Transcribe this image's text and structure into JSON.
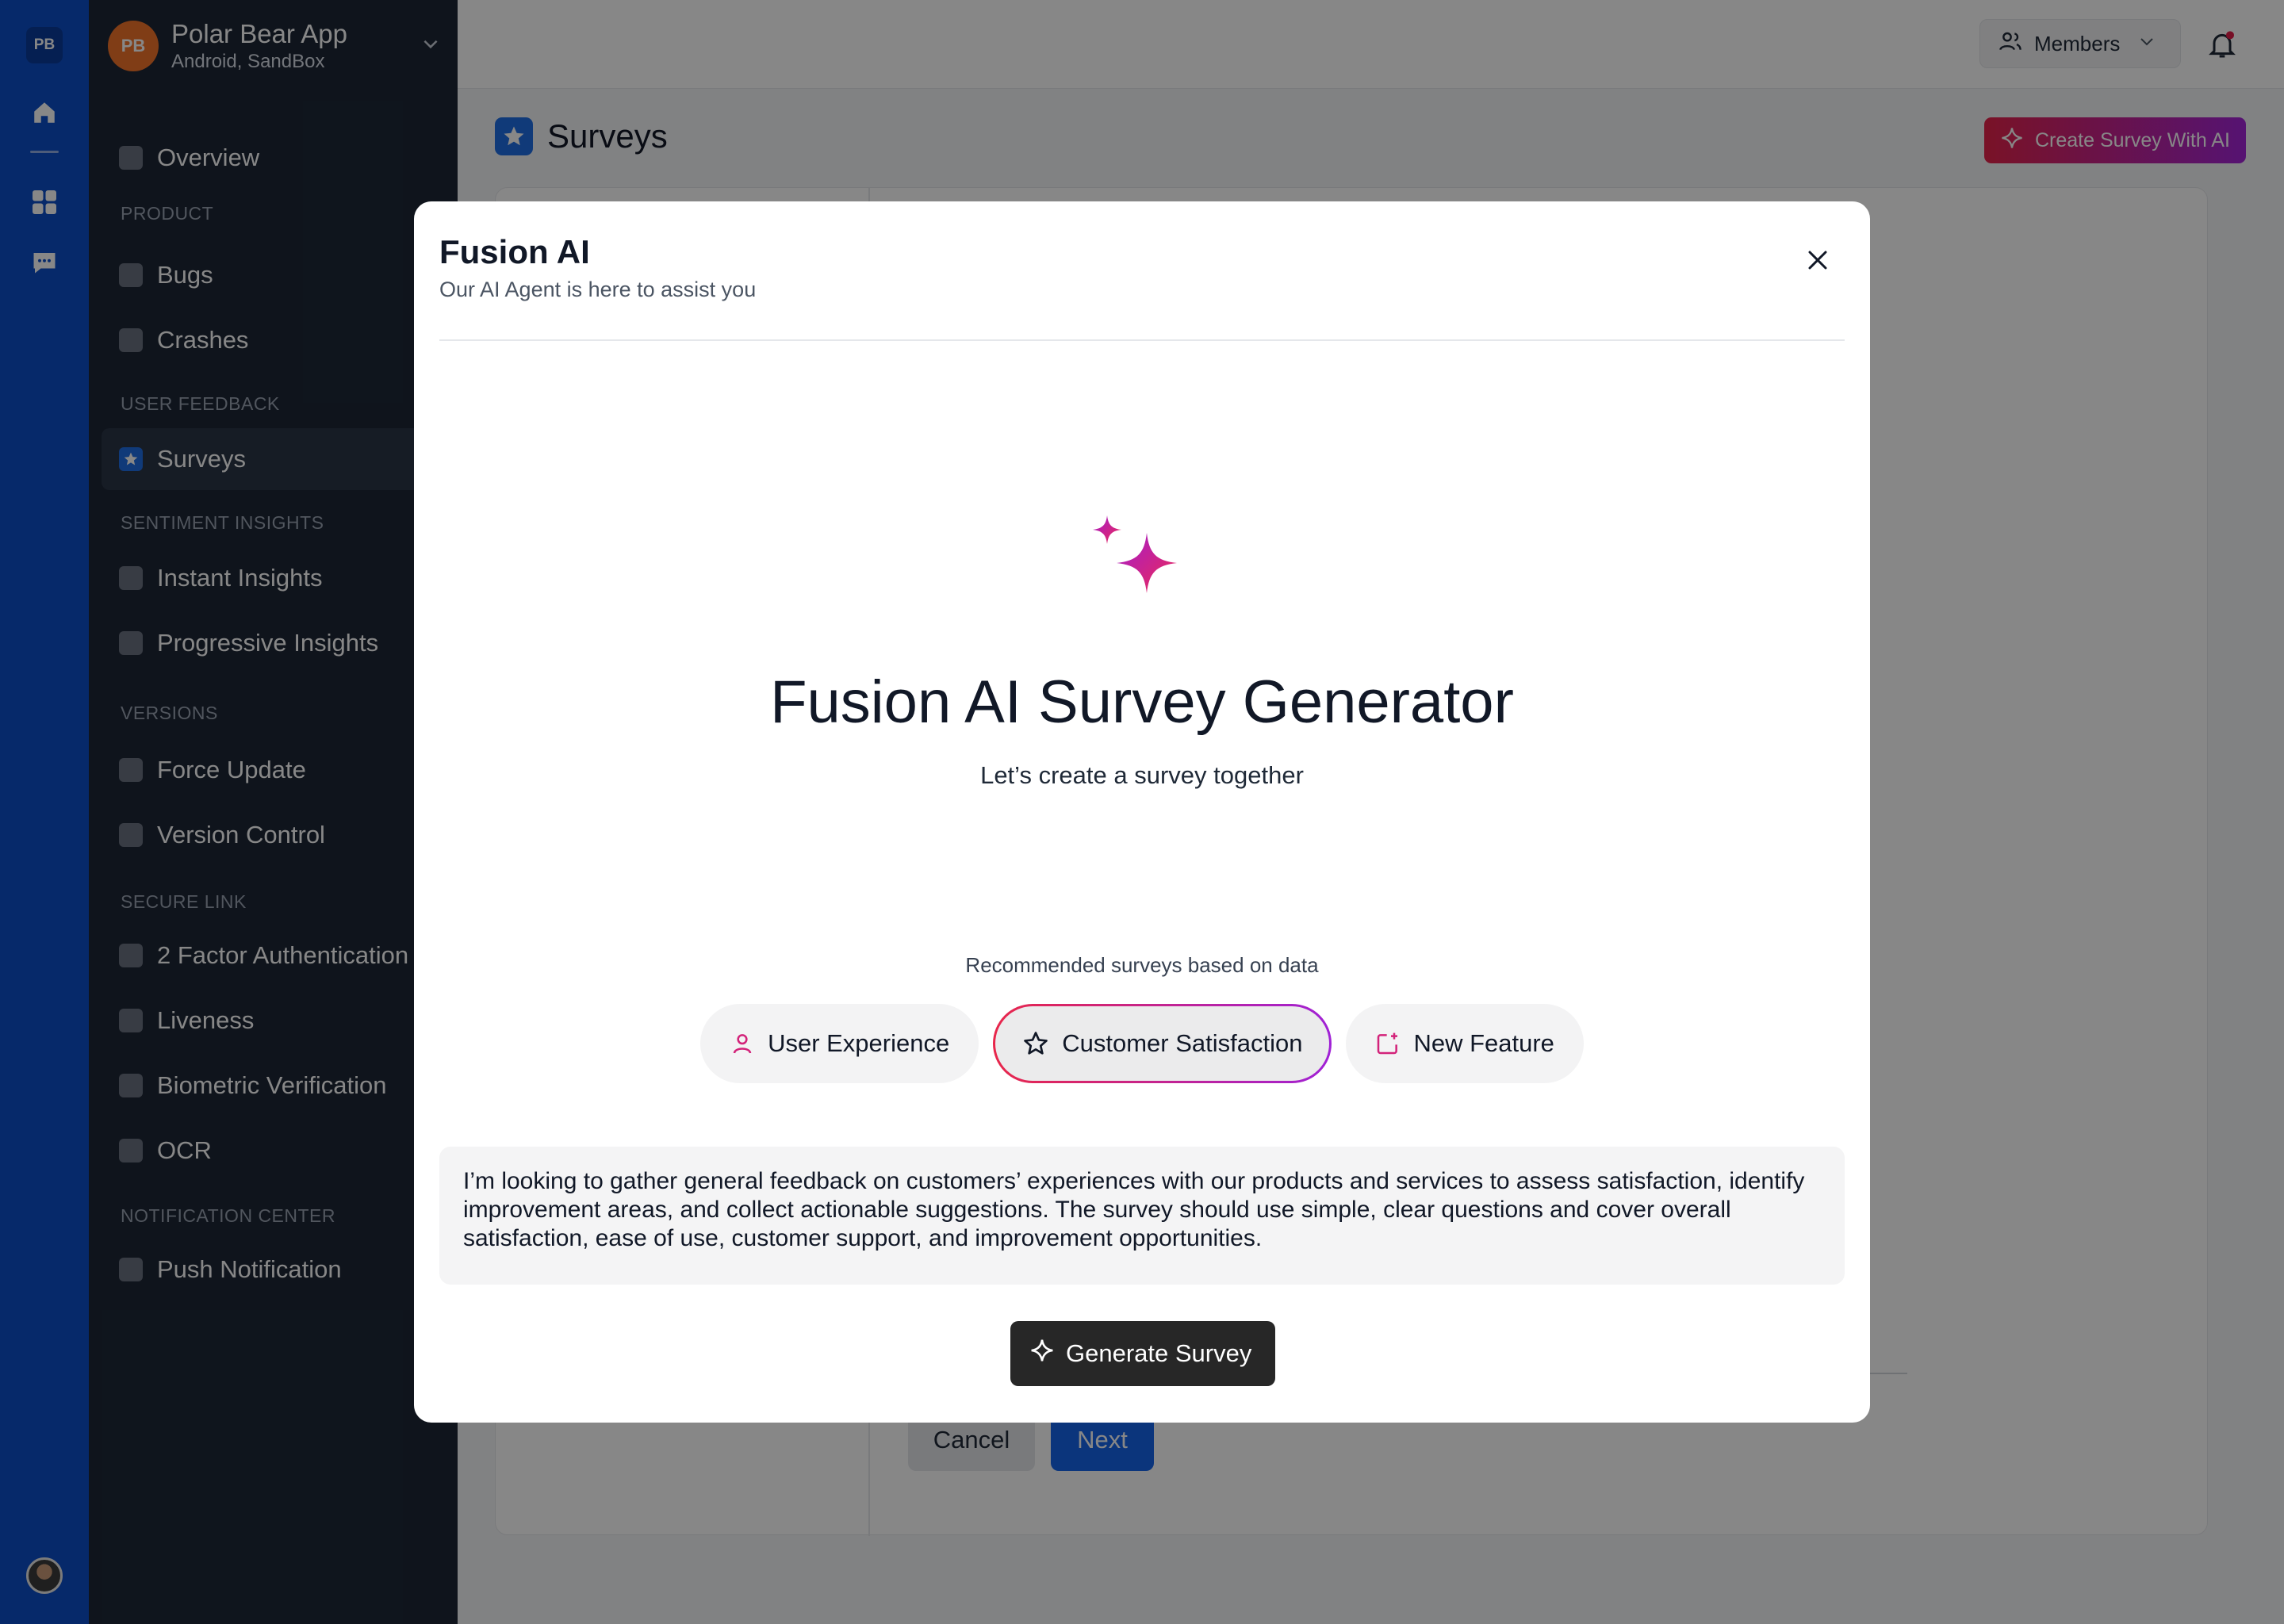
{
  "rail": {
    "logo": "PB",
    "icons": [
      "home-icon",
      "grid-icon",
      "chat-icon"
    ]
  },
  "sidebar": {
    "app": {
      "initials": "PB",
      "name": "Polar Bear App",
      "subtitle": "Android, SandBox"
    },
    "items": [
      {
        "label": "Overview"
      },
      {
        "section": "PRODUCT"
      },
      {
        "label": "Bugs"
      },
      {
        "label": "Crashes"
      },
      {
        "section": "USER FEEDBACK"
      },
      {
        "label": "Surveys"
      },
      {
        "section": "SENTIMENT INSIGHTS"
      },
      {
        "label": "Instant Insights"
      },
      {
        "label": "Progressive Insights"
      },
      {
        "section": "VERSIONS"
      },
      {
        "label": "Force Update"
      },
      {
        "label": "Version Control"
      },
      {
        "section": "SECURE LINK"
      },
      {
        "label": "2 Factor Authentication"
      },
      {
        "label": "Liveness"
      },
      {
        "label": "Biometric Verification"
      },
      {
        "label": "OCR"
      },
      {
        "section": "NOTIFICATION CENTER"
      },
      {
        "label": "Push Notification"
      }
    ]
  },
  "topbar": {
    "members_label": "Members"
  },
  "page": {
    "title": "Surveys",
    "create_ai_label": "Create Survey With AI",
    "cancel_label": "Cancel",
    "next_label": "Next"
  },
  "modal": {
    "title": "Fusion AI",
    "subtitle": "Our AI Agent is here to assist you",
    "hero_title": "Fusion AI Survey Generator",
    "hero_subtitle": "Let’s create a survey together",
    "recommended_label": "Recommended surveys based on data",
    "chips": [
      {
        "label": "User Experience",
        "icon": "user-icon",
        "selected": false
      },
      {
        "label": "Customer Satisfaction",
        "icon": "star-icon",
        "selected": true
      },
      {
        "label": "New Feature",
        "icon": "new-feature-icon",
        "selected": false
      }
    ],
    "prompt_text": "I’m looking to gather general feedback on customers’ experiences with our products and services to assess satisfaction, identify improvement areas, and collect actionable suggestions. The survey should use simple, clear questions and cover overall satisfaction, ease of use, customer support, and improvement opportunities.",
    "generate_label": "Generate Survey"
  },
  "colors": {
    "brand_blue": "#0d4fc9",
    "accent_gradient_start": "#e5234a",
    "accent_gradient_end": "#a224d8",
    "sidebar_bg": "#1d2736"
  }
}
